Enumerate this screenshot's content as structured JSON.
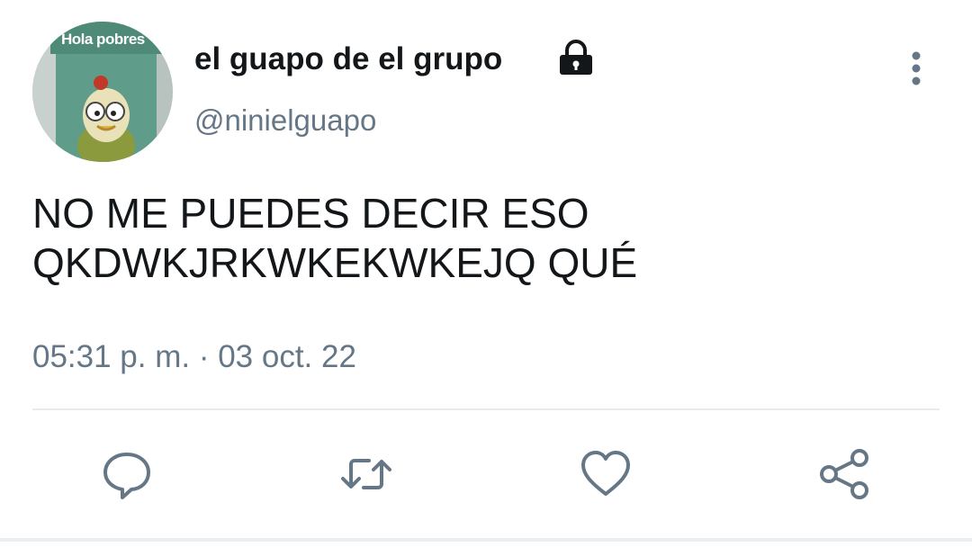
{
  "tweet": {
    "avatar_caption": "Hola pobres",
    "display_name": "el guapo de el grupo",
    "handle": "@ninielguapo",
    "protected_icon": "lock-icon",
    "more_icon": "vertical-ellipsis-icon",
    "text_lines": [
      "NO ME PUEDES DECIR ESO",
      "QKDWKJRKWKEKWKEJQ QUÉ"
    ],
    "timestamp": "05:31 p. m. · 03 oct. 22"
  },
  "actions": [
    {
      "name": "reply",
      "icon": "speech-bubble-icon"
    },
    {
      "name": "retweet",
      "icon": "retweet-arrows-icon"
    },
    {
      "name": "like",
      "icon": "heart-icon"
    },
    {
      "name": "share",
      "icon": "share-nodes-icon"
    }
  ],
  "colors": {
    "text_primary": "#14171a",
    "text_secondary": "#657786",
    "icon": "#657786",
    "divider": "#e6ecf0"
  }
}
